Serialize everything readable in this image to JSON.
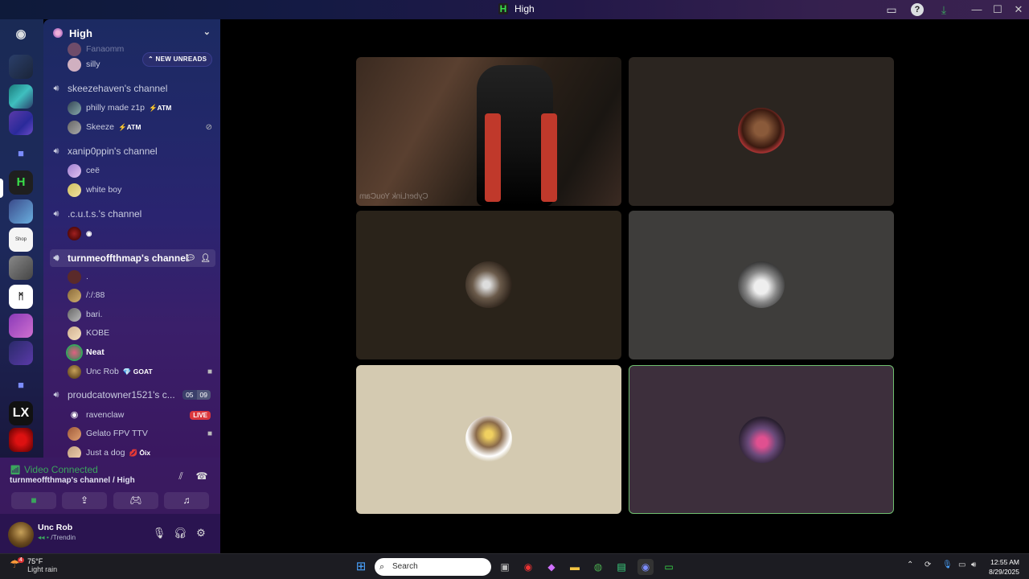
{
  "window": {
    "title": "High"
  },
  "guild": {
    "name": "High"
  },
  "new_unreads": "NEW UNREADS",
  "partial_users": {
    "top1": "Fanaomm",
    "top2": "silly"
  },
  "channels": [
    {
      "name": "skeezehaven's channel",
      "users": [
        {
          "name": "philly made z1p",
          "tag": "⚡ATM"
        },
        {
          "name": "Skeeze",
          "tag": "⚡ATM"
        }
      ]
    },
    {
      "name": "xanip0ppin's channel",
      "users": [
        {
          "name": "ceë"
        },
        {
          "name": "white boy"
        }
      ]
    },
    {
      "name": ".c.u.t.s.'s channel",
      "users": [
        {
          "name": ""
        }
      ]
    },
    {
      "name": "turnmeoffthmap's channel",
      "users": [
        {
          "name": "."
        },
        {
          "name": "/:/:88"
        },
        {
          "name": "bari."
        },
        {
          "name": "KOBE"
        },
        {
          "name": "Neat"
        },
        {
          "name": "Unc Rob",
          "tag": "💎 GOAT"
        }
      ]
    },
    {
      "name": "proudcatowner1521's c...",
      "counts": [
        "05",
        "09"
      ],
      "users": [
        {
          "name": "ravenclaw",
          "badge": "LIVE"
        },
        {
          "name": "Gelato FPV TTV"
        },
        {
          "name": "Just a dog",
          "tag": "💋 Ōix"
        }
      ]
    }
  ],
  "voice": {
    "status": "Video Connected",
    "channel": "turnmeoffthmap's channel / High"
  },
  "user": {
    "name": "Unc Rob",
    "status": "/Trendin"
  },
  "video_text": "CyberLink YouCam",
  "taskbar": {
    "temp": "75°F",
    "weather": "Light rain",
    "weather_badge": "4",
    "search_placeholder": "Search",
    "time": "12:55 AM",
    "date": "8/29/2025"
  },
  "colors": {
    "accent_green": "#3ba55d",
    "live_red": "#da373c",
    "active_speaker_border": "#6fbf6f"
  }
}
